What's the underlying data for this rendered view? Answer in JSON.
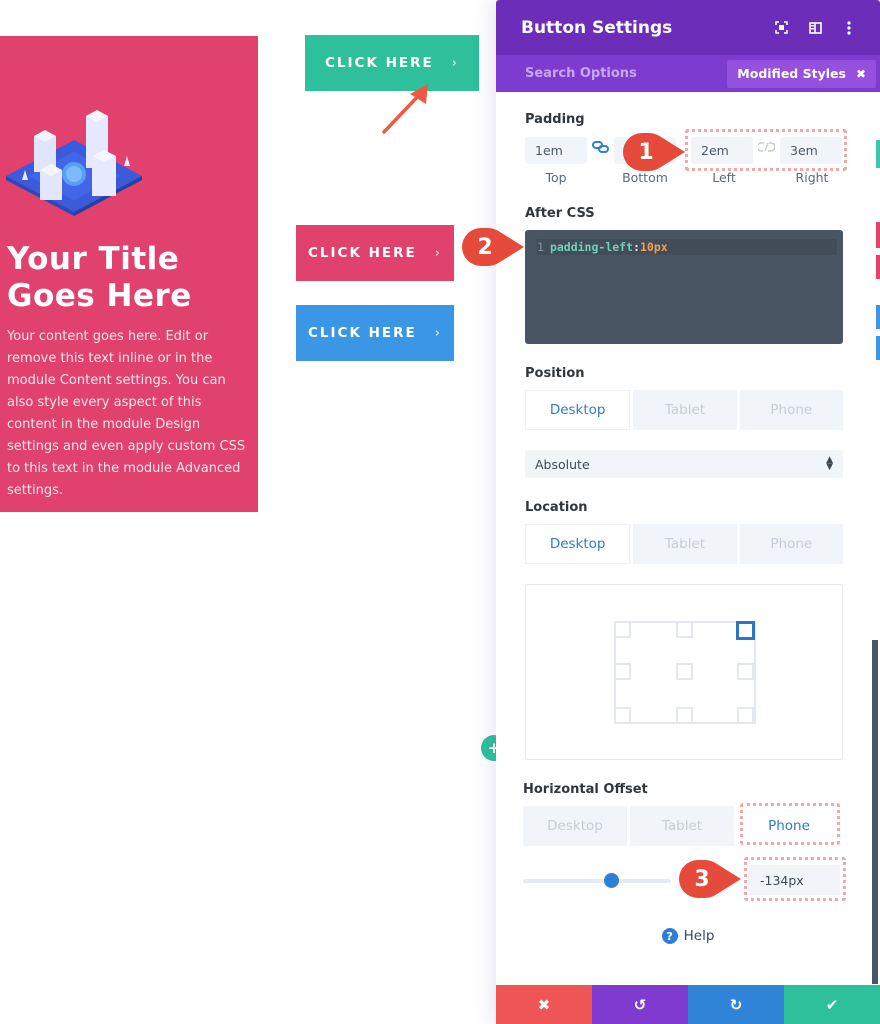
{
  "blurb": {
    "title": "Your Title Goes Here",
    "text": "Your content goes here. Edit or remove this text inline or in the module Content settings. You can also style every aspect of this content in the module Design settings and even apply custom CSS to this text in the module Advanced settings.",
    "image_icon": "isometric-city-illustration"
  },
  "buttons": [
    {
      "label": "CLICK HERE",
      "chevron": "›",
      "color": "#2ec09b"
    },
    {
      "label": "CLICK HERE",
      "chevron": "›",
      "color": "#e0416d"
    },
    {
      "label": "CLICK HERE",
      "chevron": "›",
      "color": "#3b96e6"
    }
  ],
  "panel": {
    "title": "Button Settings",
    "header_icons": [
      "expand-icon",
      "split-view-icon",
      "more-options-icon"
    ],
    "search_placeholder": "Search Options",
    "modified_styles_label": "Modified Styles",
    "modified_styles_close": "✖",
    "padding": {
      "label": "Padding",
      "top": "1em",
      "bottom": "",
      "left": "2em",
      "right": "3em",
      "captions": {
        "top": "Top",
        "bottom": "Bottom",
        "left": "Left",
        "right": "Right"
      }
    },
    "after_css": {
      "label": "After CSS",
      "line_number": "1",
      "property": "padding-left",
      "colon": ":",
      "value": "10px"
    },
    "position": {
      "label": "Position",
      "tabs": [
        "Desktop",
        "Tablet",
        "Phone"
      ],
      "active_tab": "Desktop",
      "select_value": "Absolute"
    },
    "location": {
      "label": "Location",
      "tabs": [
        "Desktop",
        "Tablet",
        "Phone"
      ],
      "active_tab": "Desktop",
      "selected_point": "top-right"
    },
    "horizontal_offset": {
      "label": "Horizontal Offset",
      "tabs": [
        "Desktop",
        "Tablet",
        "Phone"
      ],
      "active_tab": "Phone",
      "value": "-134px",
      "slider_fraction": 0.6
    },
    "help_label": "Help",
    "footer": {
      "cancel": "✖",
      "undo": "↺",
      "redo": "↻",
      "save": "✔"
    }
  },
  "annotations": [
    "1",
    "2",
    "3"
  ],
  "colors": {
    "header": "#6c2eb9",
    "subheader": "#7e3bd0",
    "accent_blue": "#2e7fd8",
    "annotation_red": "#e64a3b"
  }
}
